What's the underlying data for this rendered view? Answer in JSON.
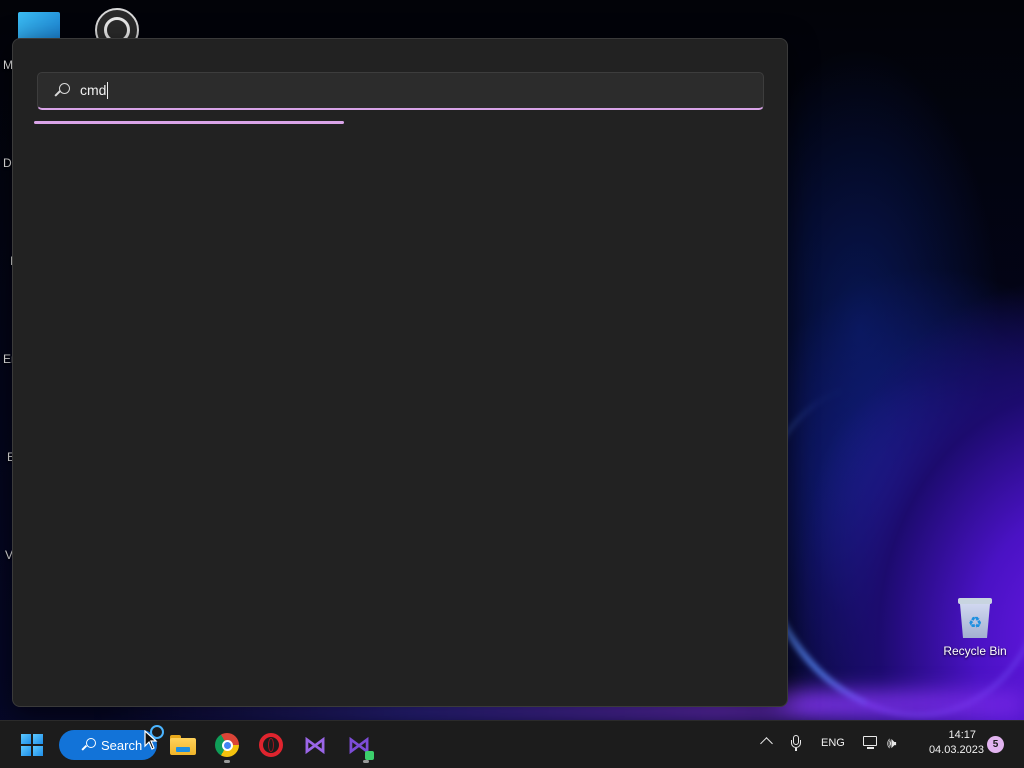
{
  "desktop": {
    "left_labels": [
      "M",
      "Da",
      "I",
      "Er",
      "E",
      "V"
    ],
    "recycle_bin": {
      "label": "Recycle Bin",
      "icon": "recycle-bin-icon"
    }
  },
  "search_panel": {
    "query": "cmd",
    "search_icon": "search-icon",
    "accent_color": "#d9a4e8",
    "loading": true
  },
  "taskbar": {
    "start_icon": "windows-logo-icon",
    "search_button_label": "Search",
    "pinned": [
      {
        "name": "File Explorer",
        "icon": "file-explorer-icon",
        "running": false
      },
      {
        "name": "Google Chrome",
        "icon": "chrome-icon",
        "running": true
      },
      {
        "name": "Opera",
        "icon": "opera-icon",
        "running": false
      },
      {
        "name": "Visual Studio",
        "icon": "visual-studio-icon",
        "running": false
      },
      {
        "name": "Visual Studio Installer",
        "icon": "visual-studio-installer-icon",
        "running": true
      }
    ],
    "tray": {
      "language": "ENG",
      "time": "14:17",
      "date": "04.03.2023",
      "notification_count": "5"
    }
  },
  "colors": {
    "taskbar_bg": "#1c1c1c",
    "panel_bg": "#222222",
    "search_pill": "#1273d8"
  }
}
